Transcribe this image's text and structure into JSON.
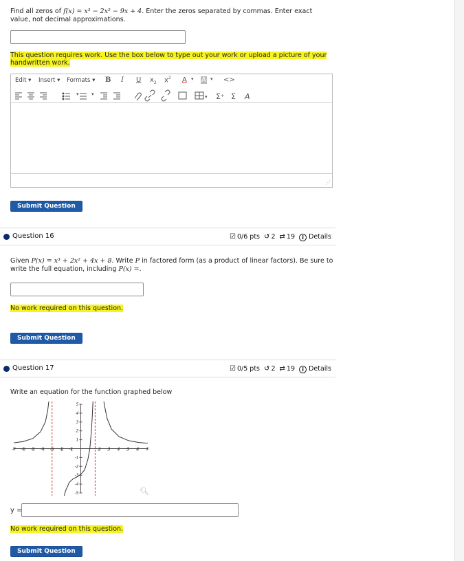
{
  "q15": {
    "prompt_prefix": "Find all zeros of",
    "function_expr": "f(x) = x³ − 2x² − 9x + 4",
    "prompt_suffix": ". Enter the zeros separated by commas. Enter exact value, not decimal approximations.",
    "answer_value": "",
    "work_notice_line1": "This question requires work.  Use the box below to type out your work or upload a picture of your",
    "work_notice_line2": "handwritten work.",
    "editor": {
      "menus": [
        "Edit",
        "Insert",
        "Formats"
      ],
      "content": ""
    },
    "submit_label": "Submit Question"
  },
  "q16": {
    "title": "Question 16",
    "score": "0/6 pts",
    "retries": "2",
    "attempts": "19",
    "details_label": "Details",
    "prompt_prefix": "Given",
    "function_expr": "P(x) = x³ + 2x² + 4x + 8",
    "prompt_middle": ". Write",
    "prompt_var": "P",
    "prompt_suffix": " in factored form (as a product of linear factors). Be sure to",
    "prompt_line2_prefix": "write the full equation, including",
    "prompt_line2_expr": "P(x) =",
    "prompt_line2_suffix": ".",
    "answer_value": "",
    "work_notice": "No work required on this question.",
    "submit_label": "Submit Question"
  },
  "q17": {
    "title": "Question 17",
    "score": "0/5 pts",
    "retries": "2",
    "attempts": "19",
    "details_label": "Details",
    "prompt": "Write an equation for the function graphed below",
    "answer_label": "y =",
    "answer_value": "",
    "work_notice": "No work required on this question.",
    "submit_label": "Submit Question"
  },
  "chart_data": {
    "type": "line",
    "xlim": [
      -7,
      7
    ],
    "ylim": [
      -5,
      5
    ],
    "x_ticks": [
      "-7",
      "-6",
      "-5",
      "-4",
      "-3",
      "-2",
      "-1",
      "2",
      "3",
      "4",
      "5",
      "6",
      "7"
    ],
    "y_ticks": [
      "5",
      "4",
      "3",
      "2",
      "1",
      "-1",
      "-2",
      "-3",
      "-4",
      "-5"
    ],
    "vertical_asymptotes": [
      -3,
      1.5
    ],
    "horizontal_asymptote": 0,
    "grid": false,
    "colors": {
      "curve": "#333333",
      "asymptote": "#e03030",
      "axis": "#555555"
    }
  }
}
